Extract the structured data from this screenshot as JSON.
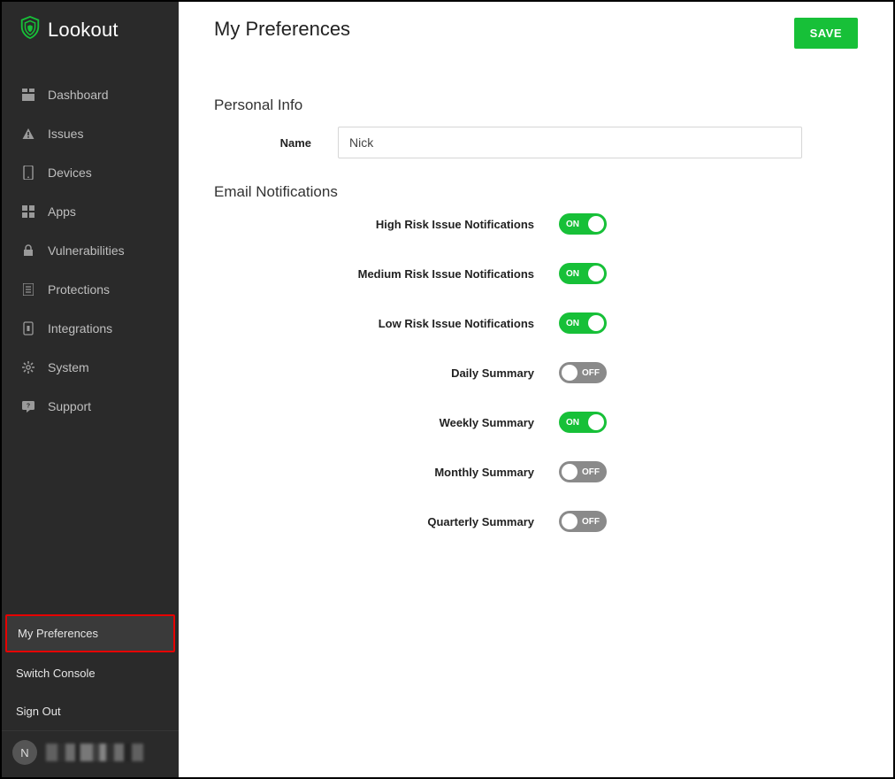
{
  "brand": {
    "name": "Lookout"
  },
  "sidebar": {
    "items": [
      {
        "icon": "dashboard",
        "label": "Dashboard"
      },
      {
        "icon": "issues",
        "label": "Issues"
      },
      {
        "icon": "devices",
        "label": "Devices"
      },
      {
        "icon": "apps",
        "label": "Apps"
      },
      {
        "icon": "vulnerabilities",
        "label": "Vulnerabilities"
      },
      {
        "icon": "protections",
        "label": "Protections"
      },
      {
        "icon": "integrations",
        "label": "Integrations"
      },
      {
        "icon": "system",
        "label": "System"
      },
      {
        "icon": "support",
        "label": "Support"
      }
    ],
    "bottom": {
      "my_preferences": "My Preferences",
      "switch_console": "Switch Console",
      "sign_out": "Sign Out"
    },
    "user_initial": "N"
  },
  "header": {
    "title": "My Preferences",
    "save_label": "SAVE"
  },
  "personal_info": {
    "section_title": "Personal Info",
    "name_label": "Name",
    "name_value": "Nick"
  },
  "email_notifications": {
    "section_title": "Email Notifications",
    "items": [
      {
        "label": "High Risk Issue Notifications",
        "state": "on"
      },
      {
        "label": "Medium Risk Issue Notifications",
        "state": "on"
      },
      {
        "label": "Low Risk Issue Notifications",
        "state": "on"
      },
      {
        "label": "Daily Summary",
        "state": "off"
      },
      {
        "label": "Weekly Summary",
        "state": "on"
      },
      {
        "label": "Monthly Summary",
        "state": "off"
      },
      {
        "label": "Quarterly Summary",
        "state": "off"
      }
    ],
    "on_label": "ON",
    "off_label": "OFF"
  }
}
